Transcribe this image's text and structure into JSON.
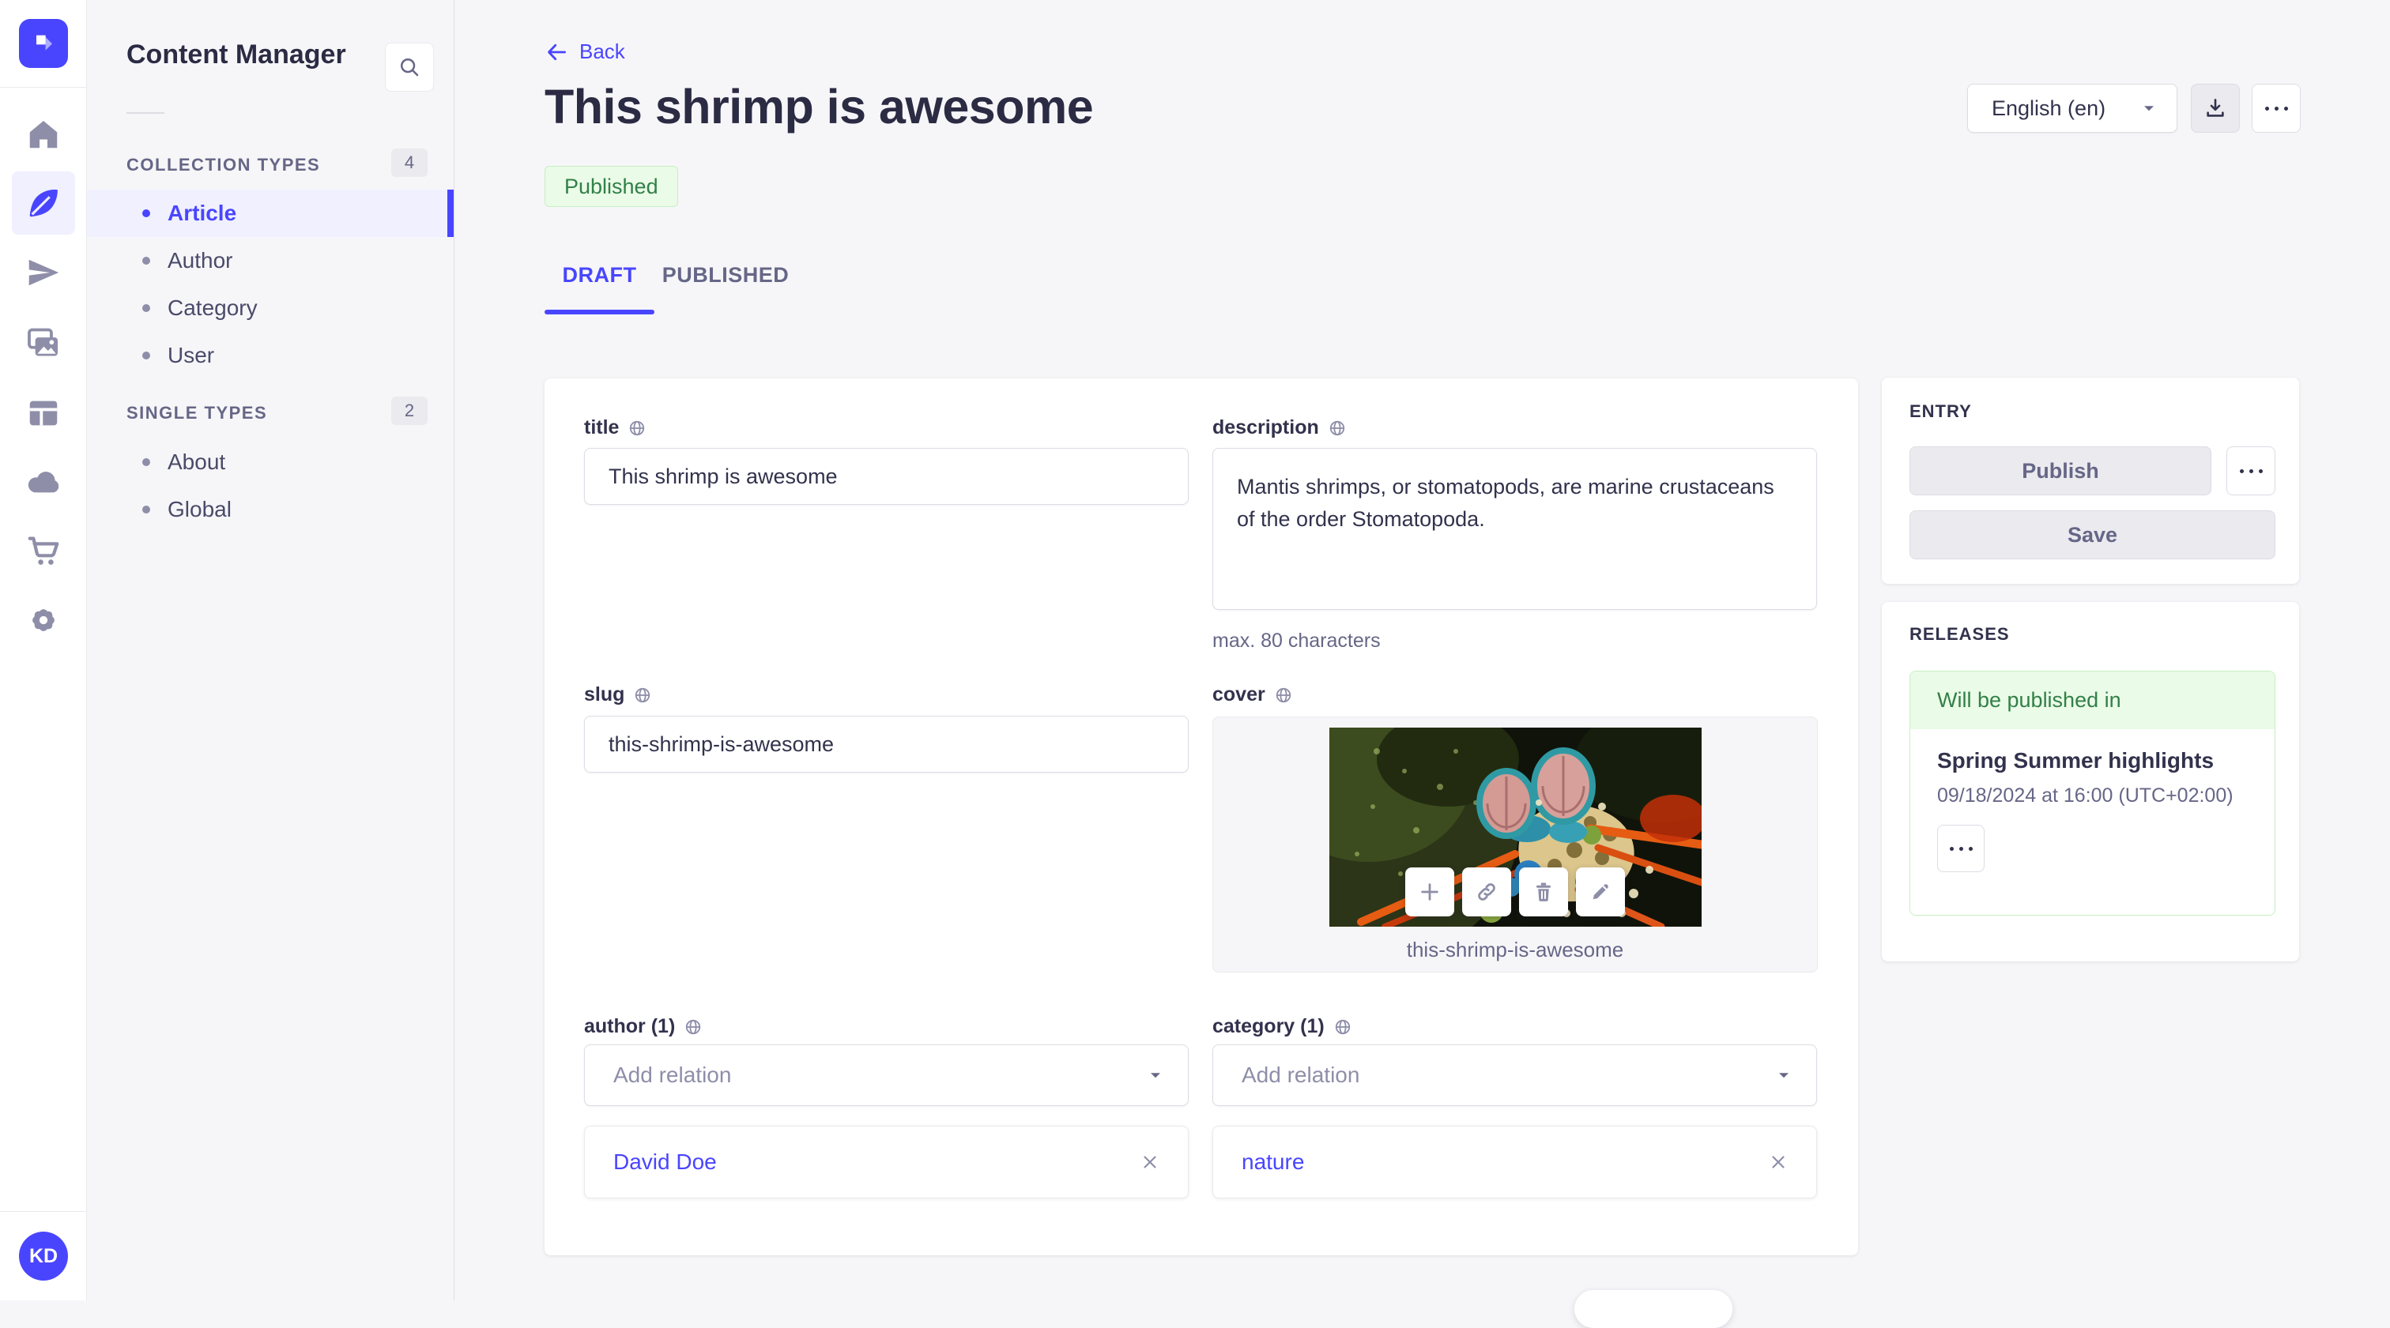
{
  "colors": {
    "primary": "#4945ff",
    "primary_light": "#f0f0ff",
    "success_text": "#328048",
    "success_bg": "#eafbe7",
    "success_border": "#c6f0c2",
    "neutral_bg": "#f6f6f9"
  },
  "icons": {
    "search": "magnifier",
    "home": "house",
    "content": "feather",
    "deploy": "paper-plane",
    "media": "images",
    "content_type": "layout",
    "cloud": "cloud",
    "marketplace": "cart",
    "settings": "gear",
    "globe": "localized-field",
    "regenerate": "circular-arrow",
    "export": "download-tray",
    "more": "ellipsis"
  },
  "nav": {
    "avatar_initials": "KD"
  },
  "sidebar": {
    "title": "Content Manager",
    "collection_types": {
      "label": "COLLECTION TYPES",
      "count": "4",
      "items": [
        "Article",
        "Author",
        "Category",
        "User"
      ]
    },
    "single_types": {
      "label": "SINGLE TYPES",
      "count": "2",
      "items": [
        "About",
        "Global"
      ]
    }
  },
  "header": {
    "back": "Back",
    "title": "This shrimp is awesome",
    "status": "Published",
    "locale": "English (en)"
  },
  "tabs": {
    "draft": "DRAFT",
    "published": "PUBLISHED"
  },
  "form": {
    "title": {
      "label": "title",
      "value": "This shrimp is awesome"
    },
    "description": {
      "label": "description",
      "value": "Mantis shrimps, or stomatopods, are marine crustaceans of the order Stomatopoda.",
      "hint": "max. 80 characters"
    },
    "slug": {
      "label": "slug",
      "value": "this-shrimp-is-awesome"
    },
    "cover": {
      "label": "cover",
      "caption": "this-shrimp-is-awesome"
    },
    "author": {
      "label": "author (1)",
      "placeholder": "Add relation",
      "item": "David Doe"
    },
    "category": {
      "label": "category (1)",
      "placeholder": "Add relation",
      "item": "nature"
    }
  },
  "entry_panel": {
    "title": "ENTRY",
    "publish": "Publish",
    "save": "Save"
  },
  "releases_panel": {
    "title": "RELEASES",
    "status": "Will be published in",
    "release": "Spring Summer highlights",
    "date": "09/18/2024 at 16:00 (UTC+02:00)"
  }
}
